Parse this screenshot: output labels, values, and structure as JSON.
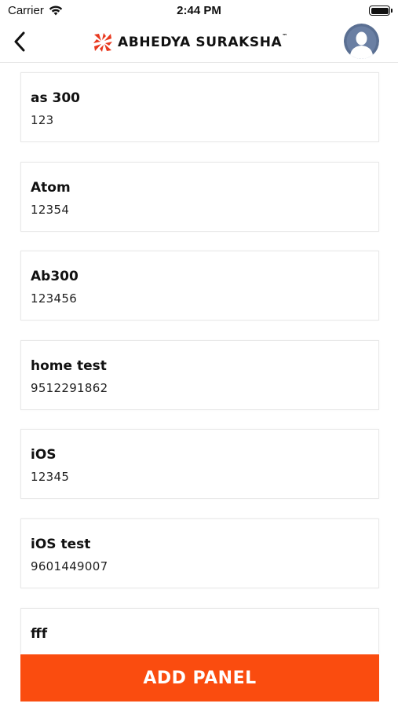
{
  "status_bar": {
    "carrier": "Carrier",
    "time": "2:44 PM",
    "icons": [
      "wifi-icon",
      "battery-icon"
    ]
  },
  "nav_bar": {
    "back_icon": "chevron-left-icon",
    "logo_text": "ABHEDYA SURAKSHA",
    "logo_tm": "™",
    "avatar_icon": "user-avatar-icon"
  },
  "colors": {
    "accent": "#fa4c0f",
    "logo_red": "#e8381e",
    "avatar_bg": "#5a6f92"
  },
  "panels": [
    {
      "name": "as 300",
      "number": "123"
    },
    {
      "name": "Atom",
      "number": "12354"
    },
    {
      "name": "Ab300",
      "number": "123456"
    },
    {
      "name": "home test",
      "number": "9512291862"
    },
    {
      "name": "iOS",
      "number": "12345"
    },
    {
      "name": "iOS test",
      "number": "9601449007"
    },
    {
      "name": "fff",
      "number": ""
    }
  ],
  "footer": {
    "add_button_label": "ADD PANEL"
  }
}
